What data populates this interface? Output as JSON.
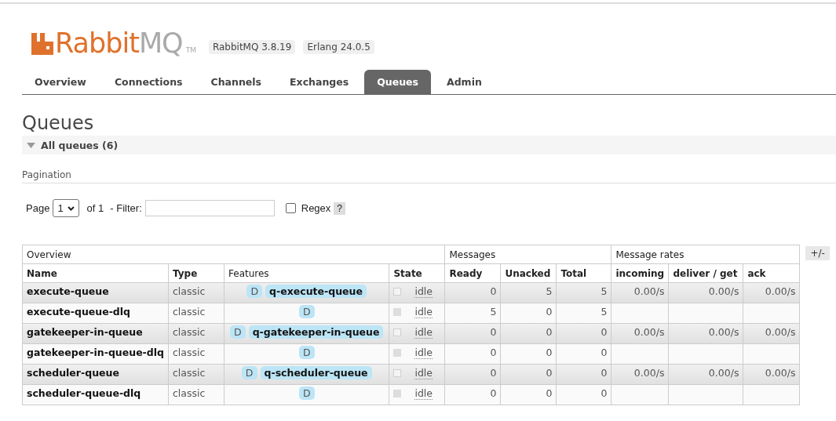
{
  "logo": {
    "brand": "Rabbit",
    "suffix": "MQ",
    "mark": "TM"
  },
  "versions": [
    "RabbitMQ 3.8.19",
    "Erlang 24.0.5"
  ],
  "tabs": [
    {
      "label": "Overview",
      "selected": false
    },
    {
      "label": "Connections",
      "selected": false
    },
    {
      "label": "Channels",
      "selected": false
    },
    {
      "label": "Exchanges",
      "selected": false
    },
    {
      "label": "Queues",
      "selected": true
    },
    {
      "label": "Admin",
      "selected": false
    }
  ],
  "heading": "Queues",
  "section": {
    "title": "All queues (6)",
    "expanded": true
  },
  "pagination": {
    "title": "Pagination",
    "page_label": "Page",
    "page": "1",
    "of": "of 1",
    "filter_label": "- Filter:",
    "regex_label": "Regex",
    "regex_checked": false,
    "help": "?"
  },
  "table": {
    "groups": [
      "Overview",
      "Messages",
      "Message rates"
    ],
    "columns": [
      "Name",
      "Type",
      "Features",
      "State",
      "Ready",
      "Unacked",
      "Total",
      "incoming",
      "deliver / get",
      "ack"
    ],
    "rows": [
      {
        "name": "execute-queue",
        "type": "classic",
        "features": [
          {
            "kind": "durable",
            "label": "D"
          },
          {
            "kind": "policy",
            "label": "q-execute-queue"
          }
        ],
        "state": "idle",
        "ready": "0",
        "unacked": "5",
        "total": "5",
        "rates": [
          "0.00/s",
          "0.00/s",
          "0.00/s"
        ]
      },
      {
        "name": "execute-queue-dlq",
        "type": "classic",
        "features": [
          {
            "kind": "durable",
            "label": "D"
          }
        ],
        "state": "idle",
        "ready": "5",
        "unacked": "0",
        "total": "5",
        "rates": []
      },
      {
        "name": "gatekeeper-in-queue",
        "type": "classic",
        "features": [
          {
            "kind": "durable",
            "label": "D"
          },
          {
            "kind": "policy",
            "label": "q-gatekeeper-in-queue"
          }
        ],
        "state": "idle",
        "ready": "0",
        "unacked": "0",
        "total": "0",
        "rates": [
          "0.00/s",
          "0.00/s",
          "0.00/s"
        ]
      },
      {
        "name": "gatekeeper-in-queue-dlq",
        "type": "classic",
        "features": [
          {
            "kind": "durable",
            "label": "D"
          }
        ],
        "state": "idle",
        "ready": "0",
        "unacked": "0",
        "total": "0",
        "rates": []
      },
      {
        "name": "scheduler-queue",
        "type": "classic",
        "features": [
          {
            "kind": "durable",
            "label": "D"
          },
          {
            "kind": "policy",
            "label": "q-scheduler-queue"
          }
        ],
        "state": "idle",
        "ready": "0",
        "unacked": "0",
        "total": "0",
        "rates": [
          "0.00/s",
          "0.00/s",
          "0.00/s"
        ]
      },
      {
        "name": "scheduler-queue-dlq",
        "type": "classic",
        "features": [
          {
            "kind": "durable",
            "label": "D"
          }
        ],
        "state": "idle",
        "ready": "0",
        "unacked": "0",
        "total": "0",
        "rates": []
      }
    ],
    "columns_button": "+/-"
  }
}
